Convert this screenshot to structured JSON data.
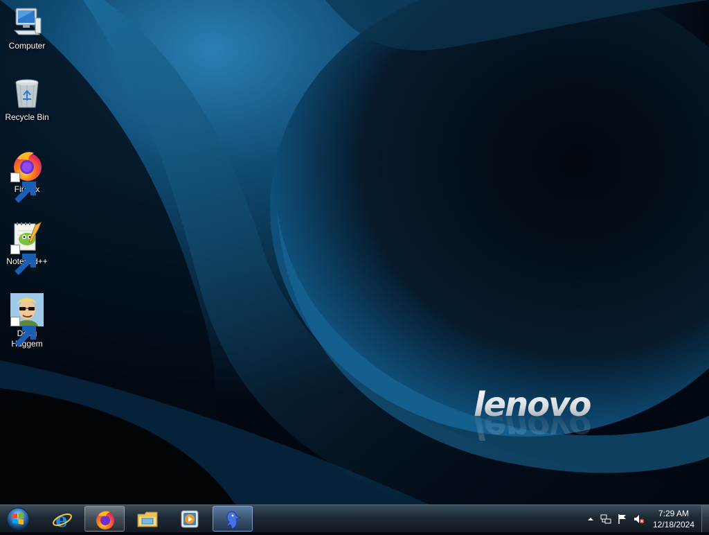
{
  "desktop": {
    "wallpaper_brand": "lenovo",
    "icons": [
      {
        "label": "Computer",
        "icon": "computer-icon"
      },
      {
        "label": "Recycle Bin",
        "icon": "recycle-bin-icon"
      },
      {
        "label": "Firefox",
        "icon": "firefox-icon"
      },
      {
        "label": "Notepad++",
        "icon": "notepad-plus-plus-icon"
      },
      {
        "label": "Doug\nHuggem",
        "icon": "doug-huggem-icon"
      }
    ]
  },
  "taskbar": {
    "pinned": [
      {
        "name": "Internet Explorer",
        "icon": "internet-explorer-icon",
        "state": "pinned"
      },
      {
        "name": "Firefox",
        "icon": "firefox-icon",
        "state": "running"
      },
      {
        "name": "Windows Explorer",
        "icon": "file-explorer-icon",
        "state": "pinned"
      },
      {
        "name": "Windows Media Player",
        "icon": "media-player-icon",
        "state": "pinned"
      },
      {
        "name": "Doug Huggem",
        "icon": "doug-huggem-icon",
        "state": "active"
      }
    ],
    "tray": {
      "icons": [
        "show-hidden-icons-arrow",
        "network-icon",
        "action-center-flag-icon",
        "volume-muted-icon"
      ],
      "time": "7:29 AM",
      "date": "12/18/2024"
    }
  },
  "colors": {
    "taskbar_top": "#3c4d5b",
    "taskbar_bottom": "#121b23",
    "wallpaper_accent": "#1a6a9a"
  }
}
